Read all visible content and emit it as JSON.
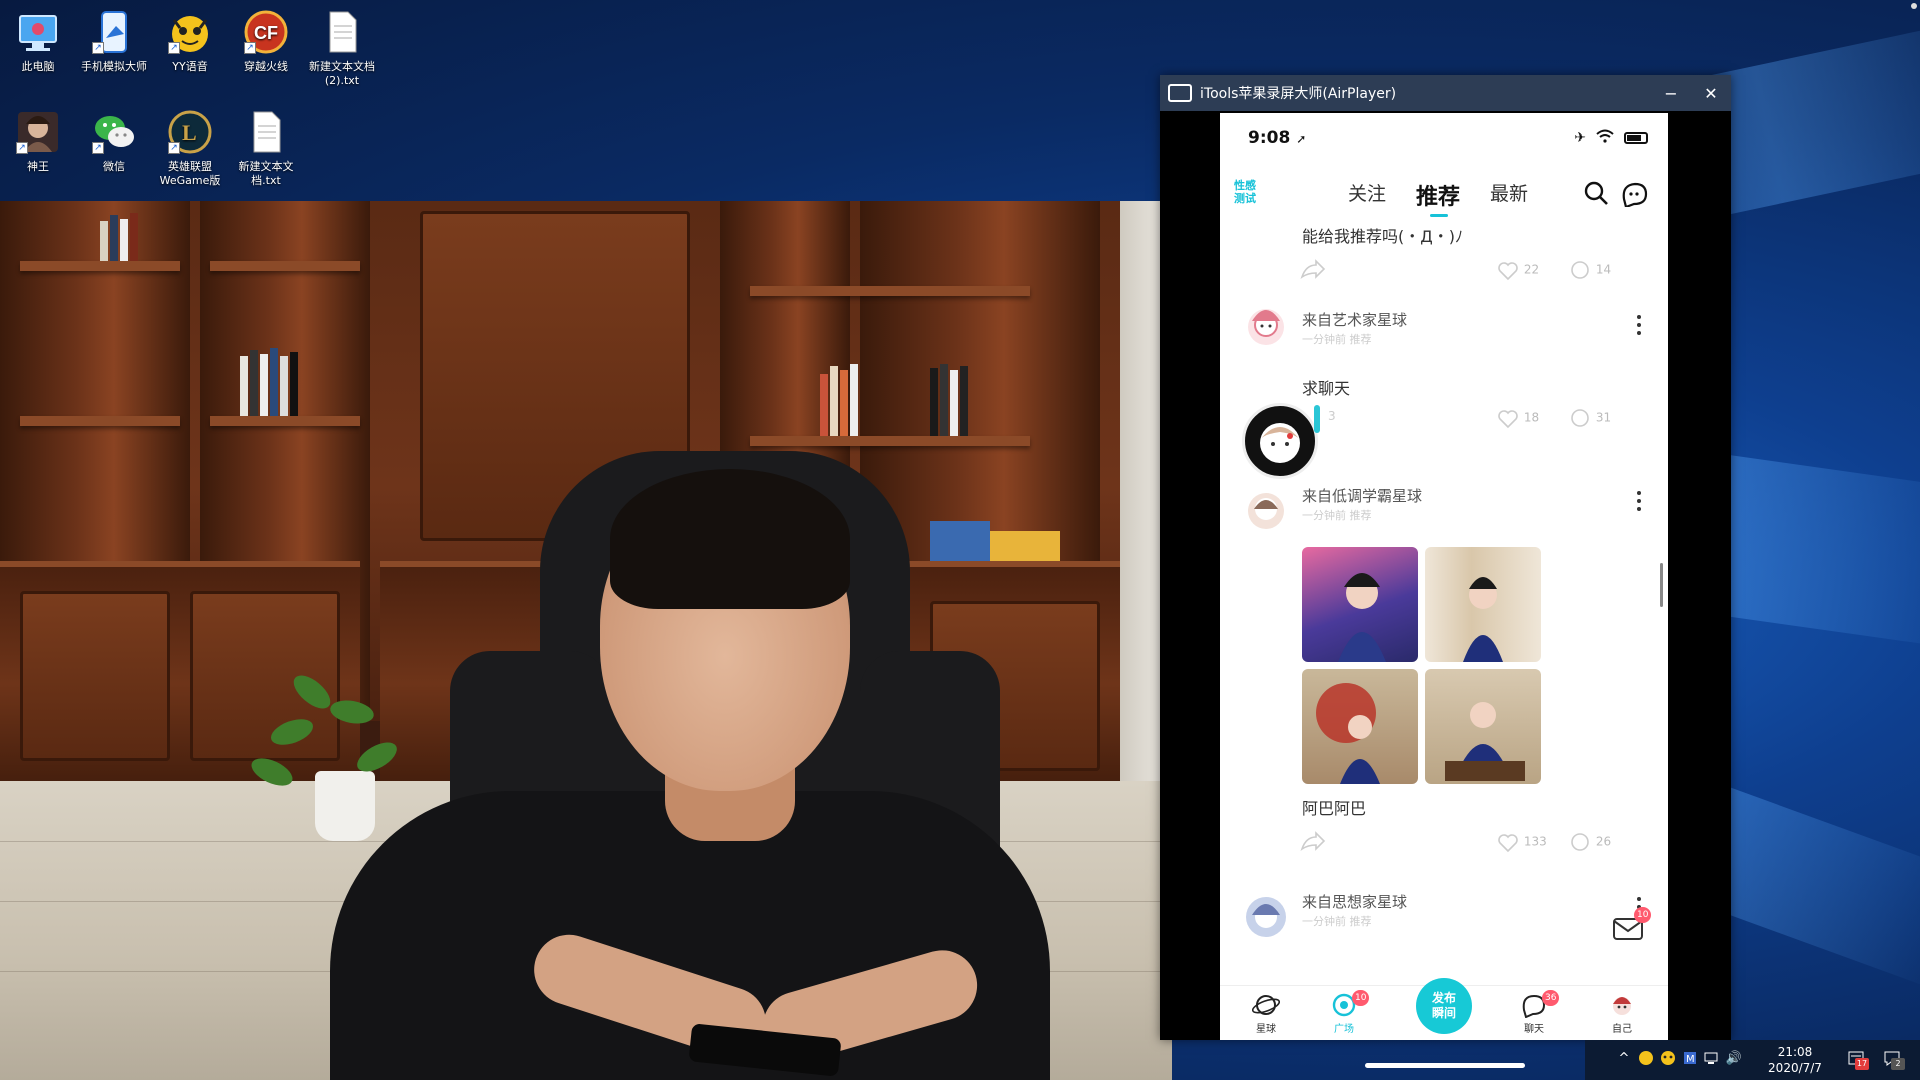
{
  "desktop": {
    "icons": [
      {
        "label": "此电脑",
        "icon": "this-pc-icon"
      },
      {
        "label": "手机模拟大师",
        "icon": "phone-emulator-icon"
      },
      {
        "label": "YY语音",
        "icon": "yy-voice-icon"
      },
      {
        "label": "穿越火线",
        "icon": "crossfire-icon"
      },
      {
        "label": "新建文本文档\n(2).txt",
        "icon": "text-file-icon"
      },
      {
        "label": "神王",
        "icon": "game-shenwang-icon"
      },
      {
        "label": "微信",
        "icon": "wechat-icon"
      },
      {
        "label": "英雄联盟\nWeGame版",
        "icon": "lol-icon"
      },
      {
        "label": "新建文本文\n档.txt",
        "icon": "text-file-icon"
      }
    ]
  },
  "itools": {
    "title": "iTools苹果录屏大师(AirPlayer)",
    "minimize": "−",
    "close": "✕"
  },
  "phone": {
    "status": {
      "time": "9:08",
      "location_arrow": "➚",
      "airplane": "✈",
      "wifi": "wifi-icon"
    },
    "logo": "性感\n测试",
    "tabs": [
      {
        "label": "关注",
        "active": false
      },
      {
        "label": "推荐",
        "active": true
      },
      {
        "label": "最新",
        "active": false
      }
    ],
    "posts": [
      {
        "text": "能给我推荐吗(・Д・)ﾉ",
        "likes": "22",
        "comments": "14"
      },
      {
        "user": "来自艺术家星球",
        "sub": "一分钟前 推荐",
        "text": "求聊天",
        "likes": "18",
        "comments": "31",
        "share_count": "3"
      },
      {
        "user": "来自低调学霸星球",
        "sub": "一分钟前 推荐",
        "text": "阿巴阿巴",
        "likes": "133",
        "comments": "26",
        "photos": 4
      },
      {
        "user": "来自思想家星球",
        "sub": "一分钟前 推荐"
      }
    ],
    "tabbar": [
      {
        "label": "星球"
      },
      {
        "label": "广场",
        "badge": "10"
      },
      {
        "label": "发布\n瞬间"
      },
      {
        "label": "聊天",
        "badge": "36"
      },
      {
        "label": "自己"
      }
    ],
    "mail_badge": "10"
  },
  "taskbar": {
    "time": "21:08",
    "date": "2020/7/7",
    "tray_up": "^",
    "volume": "🔊",
    "notif_count": "17",
    "action_center_count": "2"
  },
  "colors": {
    "accent": "#17c2d8",
    "badge": "#ff5a6e",
    "titlebar": "#2d3d55"
  }
}
